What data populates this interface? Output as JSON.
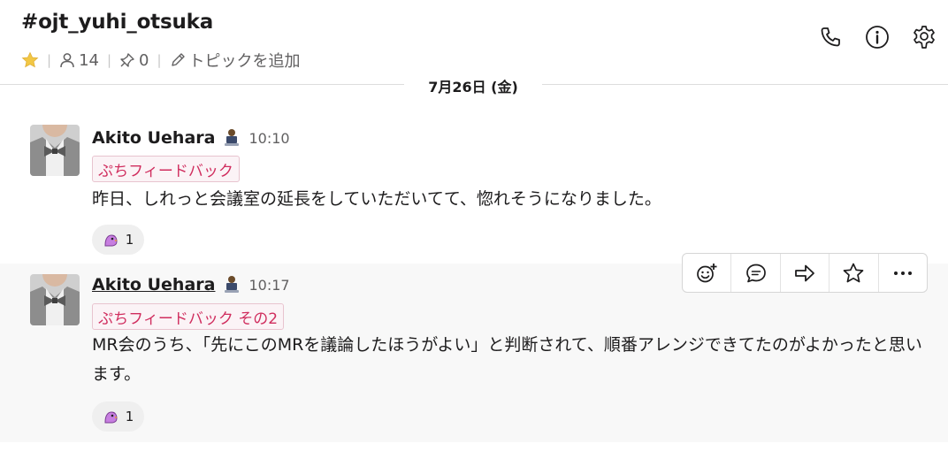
{
  "channel": {
    "name": "#ojt_yuhi_otsuka",
    "members": "14",
    "pins": "0",
    "topic": "トピックを追加"
  },
  "date_divider": "7月26日 (金)",
  "messages": [
    {
      "author": "Akito Uehara",
      "time": "10:10",
      "tag": "ぷちフィードバック",
      "text": "昨日、しれっと会議室の延長をしていただいてて、惚れそうになりました。",
      "reaction_count": "1"
    },
    {
      "author": "Akito Uehara",
      "time": "10:17",
      "tag": "ぷちフィードバック その2",
      "text": "MR会のうち、「先にこのMRを議論したほうがよい」と判断されて、順番アレンジできてたのがよかったと思います。",
      "reaction_count": "1"
    }
  ],
  "colors": {
    "star": "#f2c744",
    "tag_text": "#d02d5e",
    "hover_bg": "#f8f8f8"
  },
  "icons": [
    "star-icon",
    "person-icon",
    "pin-icon",
    "pencil-icon",
    "phone-icon",
    "info-icon",
    "gear-icon",
    "add-reaction-icon",
    "reply-icon",
    "share-icon",
    "save-star-icon",
    "more-icon",
    "bird-emoji-icon",
    "laptop-emoji-icon"
  ]
}
